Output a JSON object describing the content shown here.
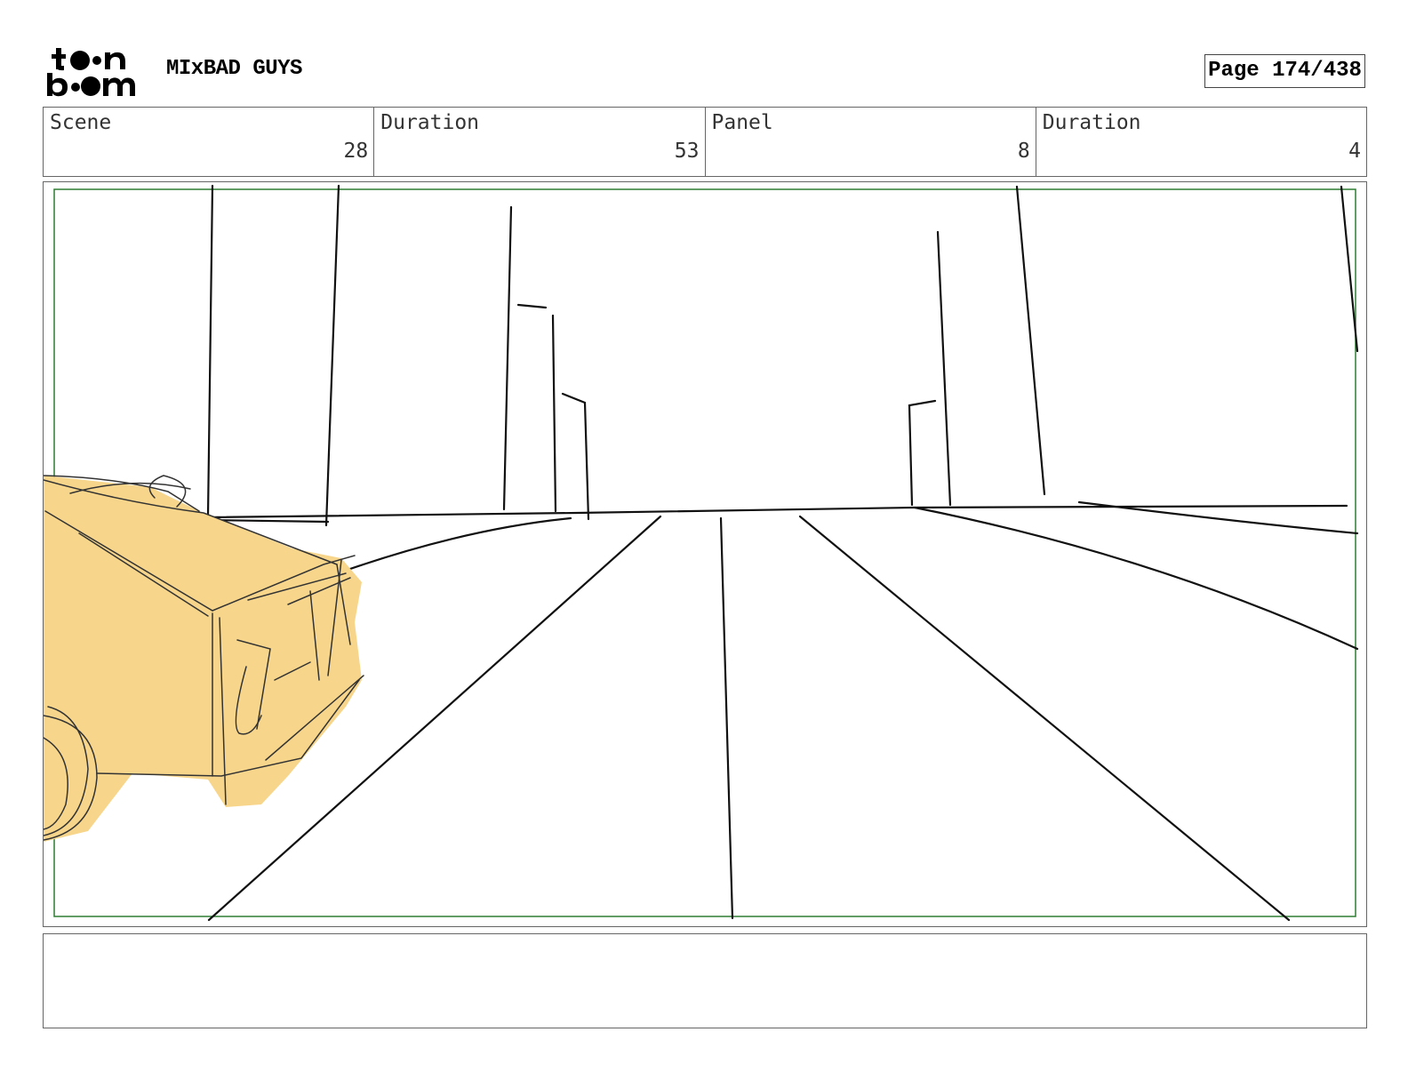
{
  "header": {
    "logo_text": "toon boom",
    "project_title": "MIxBAD GUYS",
    "page_label": "Page 174/438"
  },
  "info": {
    "scene_label": "Scene",
    "scene_value": "28",
    "scene_duration_label": "Duration",
    "scene_duration_value": "53",
    "panel_label": "Panel",
    "panel_value": "8",
    "panel_duration_label": "Duration",
    "panel_duration_value": "4"
  },
  "colors": {
    "safe_frame": "#2e7d32",
    "car_fill": "#f7d68c",
    "ink": "#111111"
  },
  "notes": {
    "text": ""
  }
}
